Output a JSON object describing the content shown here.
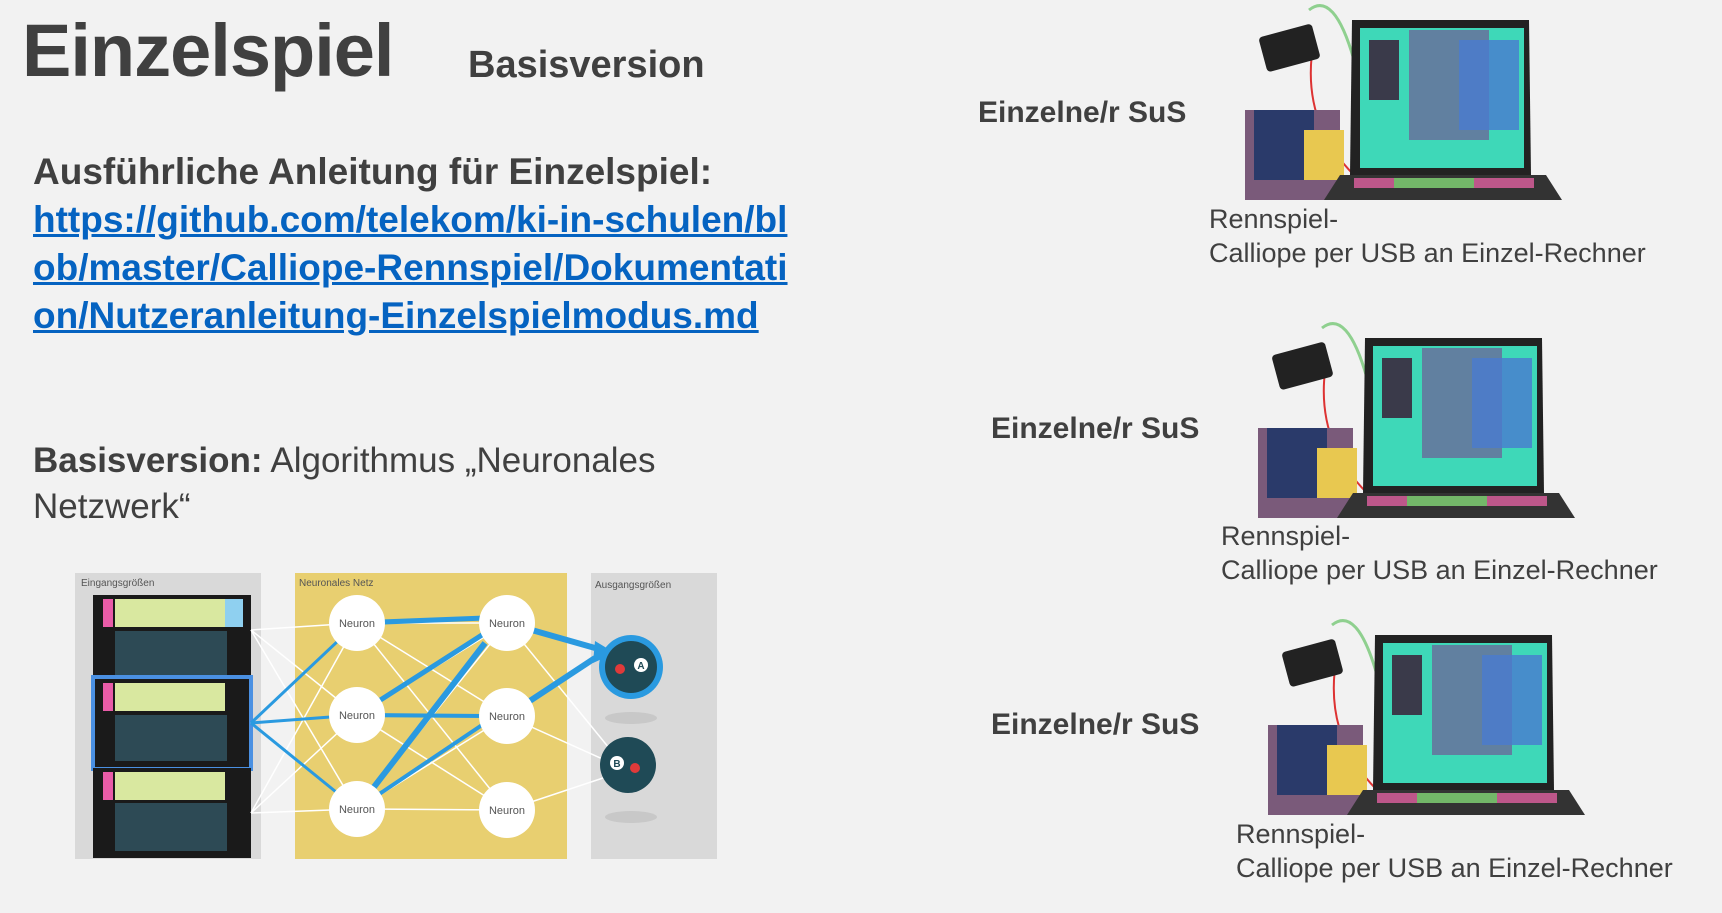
{
  "title": "Einzelspiel",
  "subtitle": "Basisversion",
  "heading": "Ausführliche Anleitung für Einzelspiel:",
  "link": "https://github.com/telekom/ki-in-schulen/blob/master/Calliope-Rennspiel/Dokumentation/Nutzeranleitung-Einzelspielmodus.md",
  "basis": {
    "label": "Basisversion:",
    "text": " Algorithmus „Neuronales Netzwerk“"
  },
  "diagram": {
    "input_label": "Eingangsgrößen",
    "net_label": "Neuronales Netz",
    "output_label": "Ausgangsgrößen",
    "neuron_label": "Neuron",
    "output_a": "A",
    "output_b": "B"
  },
  "setups": [
    {
      "label": "Einzelne/r SuS",
      "caption_line1": "Rennspiel-",
      "caption_line2": "Calliope per USB an Einzel-Rechner"
    },
    {
      "label": "Einzelne/r SuS",
      "caption_line1": "Rennspiel-",
      "caption_line2": "Calliope per USB an Einzel-Rechner"
    },
    {
      "label": "Einzelne/r SuS",
      "caption_line1": "Rennspiel-",
      "caption_line2": "Calliope per USB an Einzel-Rechner"
    }
  ],
  "colors": {
    "text": "#404040",
    "link": "#0563c1",
    "net_background": "#e8cf70",
    "arrow_blue": "#2a9ae0",
    "screen_teal": "#3ed8b8"
  }
}
